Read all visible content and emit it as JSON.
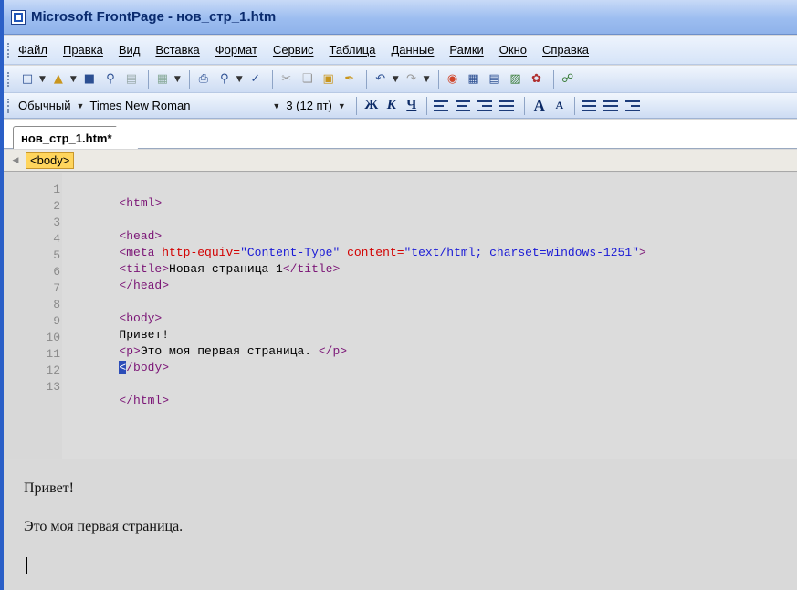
{
  "window": {
    "title": "Microsoft FrontPage - нов_стр_1.htm"
  },
  "menu": {
    "items": [
      "Файл",
      "Правка",
      "Вид",
      "Вставка",
      "Формат",
      "Сервис",
      "Таблица",
      "Данные",
      "Рамки",
      "Окно",
      "Справка"
    ]
  },
  "formatting": {
    "style": "Обычный",
    "font": "Times New Roman",
    "size": "3 (12 пт)",
    "bold": "Ж",
    "italic": "К",
    "underline": "Ч",
    "grow_font": "A",
    "shrink_font": "A"
  },
  "document": {
    "tab_label": "нов_стр_1.htm*",
    "tag_selector": "<body>"
  },
  "code": {
    "line_numbers": [
      "1",
      "2",
      "3",
      "4",
      "5",
      "6",
      "7",
      "8",
      "9",
      "10",
      "11",
      "12",
      "13"
    ],
    "l1": "<html>",
    "l3": "<head>",
    "l4_tag_open": "<meta",
    "l4_attr1": " http-equiv=",
    "l4_val1": "\"Content-Type\"",
    "l4_attr2": " content=",
    "l4_val2": "\"text/html; charset=windows-1251\"",
    "l4_tag_close": ">",
    "l5_open": "<title>",
    "l5_text": "Новая страница 1",
    "l5_close": "</title>",
    "l6": "</head>",
    "l8": "<body>",
    "l9": "Привет!",
    "l10_open": "<p>",
    "l10_text": "Это моя первая страница. ",
    "l10_close": "</p>",
    "l11_caret": "<",
    "l11_rest": "/body>",
    "l13": "</html>"
  },
  "preview": {
    "line1": "Привет!",
    "line2": "Это моя первая страница."
  },
  "colors": {
    "tag": "#7b1576",
    "attribute": "#d20000",
    "value": "#1a1ad6",
    "selection": "#2c4db8"
  }
}
